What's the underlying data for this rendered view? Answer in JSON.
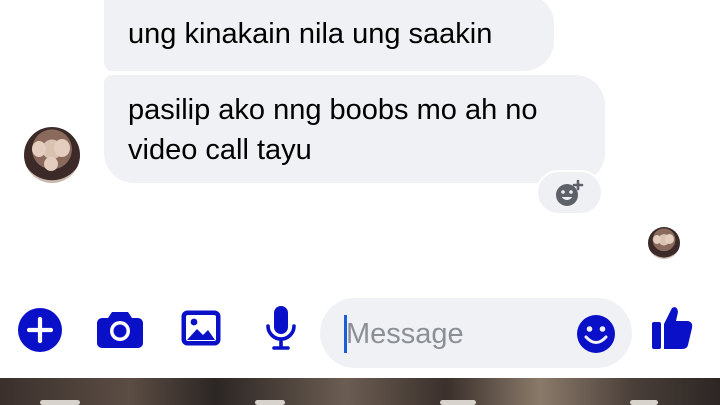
{
  "colors": {
    "accent": "#0a10c8",
    "bubble_bg": "#f0f1f4",
    "placeholder": "#8b8f96",
    "caret": "#1a5fd6"
  },
  "messages": [
    {
      "text": "ung kinakain nila ung saakin"
    },
    {
      "lines": [
        "pasilip ako nng boobs mo ah no",
        "video call tayu"
      ]
    }
  ],
  "reaction": {
    "icon": "add-reaction-icon"
  },
  "composer": {
    "tools": [
      {
        "icon": "plus-icon"
      },
      {
        "icon": "camera-icon"
      },
      {
        "icon": "gallery-icon"
      },
      {
        "icon": "microphone-icon"
      }
    ],
    "message_placeholder": "Message",
    "emoji_icon": "smiley-icon",
    "like_icon": "thumbs-up-icon"
  }
}
